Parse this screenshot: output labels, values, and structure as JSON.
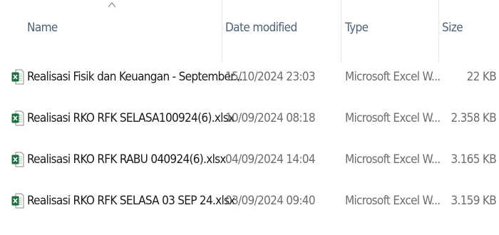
{
  "columns": {
    "name": "Name",
    "date": "Date modified",
    "type": "Type",
    "size": "Size",
    "sort_indicator": "chevron-up-icon"
  },
  "files": [
    {
      "icon": "excel-file-icon",
      "name": "Realisasi Fisik dan Keuangan - September...",
      "date": "15/10/2024 23:03",
      "type": "Microsoft Excel W...",
      "size": "22 KB"
    },
    {
      "icon": "excel-file-icon",
      "name": "Realisasi RKO RFK  SELASA100924(6).xlsx",
      "date": "10/09/2024 08:18",
      "type": "Microsoft Excel W...",
      "size": "2.358 KB"
    },
    {
      "icon": "excel-file-icon",
      "name": "Realisasi RKO RFK RABU 040924(6).xlsx",
      "date": "04/09/2024 14:04",
      "type": "Microsoft Excel W...",
      "size": "3.165 KB"
    },
    {
      "icon": "excel-file-icon",
      "name": "Realisasi RKO RFK SELASA 03 SEP 24.xlsx",
      "date": "03/09/2024 09:40",
      "type": "Microsoft Excel W...",
      "size": "3.159 KB"
    }
  ],
  "colors": {
    "excel_green": "#1d6f42",
    "header_text": "#4c607a",
    "detail_text": "#6d6d6d"
  }
}
